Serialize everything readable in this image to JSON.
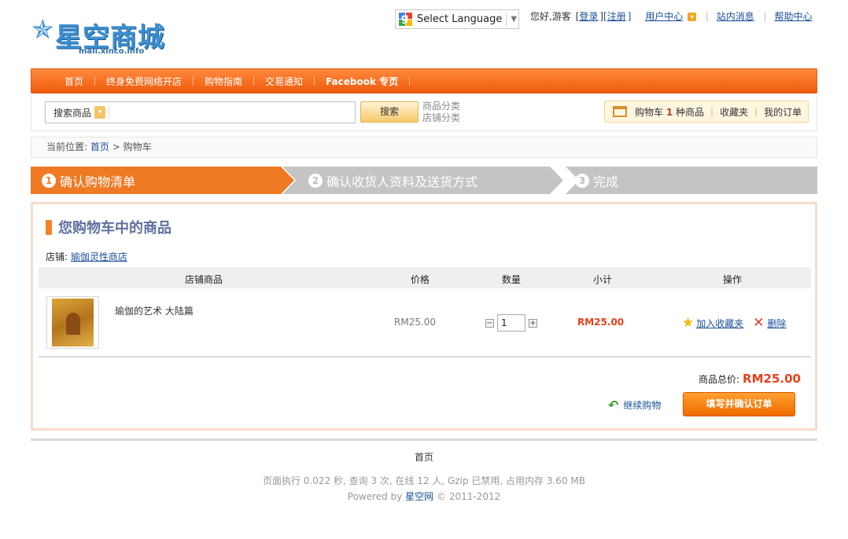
{
  "brand": {
    "logo_text": "星空商城",
    "logo_sub": "mall.xinco.info"
  },
  "language": {
    "label": "Select Language"
  },
  "top_links": {
    "greeting": "您好,游客",
    "login": "登录",
    "register": "注册",
    "user_center": "用户中心",
    "messages": "站内消息",
    "help": "帮助中心"
  },
  "nav": {
    "items": [
      {
        "label": "首页"
      },
      {
        "label": "终身免费网络开店"
      },
      {
        "label": "购物指南"
      },
      {
        "label": "交易通知"
      },
      {
        "label": "Facebook 专页"
      }
    ]
  },
  "search": {
    "category_label": "搜索商品",
    "value": "",
    "button": "搜索",
    "link_goods_category": "商品分类",
    "link_shop_category": "店铺分类"
  },
  "mini_cart": {
    "cart_prefix": "购物车",
    "cart_count": "1",
    "cart_suffix": "种商品",
    "favorites": "收藏夹",
    "orders": "我的订单"
  },
  "breadcrumb": {
    "prefix": "当前位置:",
    "home": "首页",
    "separator": ">",
    "current": "购物车"
  },
  "steps": [
    {
      "num": "1",
      "label": "确认购物清单",
      "active": true
    },
    {
      "num": "2",
      "label": "确认收货人资料及送货方式",
      "active": false
    },
    {
      "num": "3",
      "label": "完成",
      "active": false
    }
  ],
  "cart": {
    "title": "您购物车中的商品",
    "shop_label": "店铺:",
    "shop_name": "瑜伽灵性商店",
    "columns": {
      "product": "店铺商品",
      "price": "价格",
      "quantity": "数量",
      "subtotal": "小计",
      "actions": "操作"
    },
    "items": [
      {
        "name": "瑜伽的艺术 大陆篇",
        "price": "RM25.00",
        "quantity": "1",
        "subtotal": "RM25.00",
        "add_favorite": "加入收藏夹",
        "delete": "删除"
      }
    ],
    "total_label": "商品总价:",
    "total_value": "RM25.00",
    "continue_shopping": "继续购物",
    "confirm_button": "填写并确认订单"
  },
  "footer": {
    "home_link": "首页",
    "stats": "页面执行 0.022 秒, 查询 3 次, 在线 12 人, Gzip 已禁用, 占用内存 3.60 MB",
    "powered_prefix": "Powered by",
    "powered_link": "星空网",
    "copyright": "© 2011-2012"
  },
  "colors": {
    "accent_orange": "#f07a24",
    "nav_orange": "#ef5a0c",
    "price_red": "#e8401c",
    "link_blue": "#1a4f9c",
    "step_inactive": "#c4c4c4"
  }
}
